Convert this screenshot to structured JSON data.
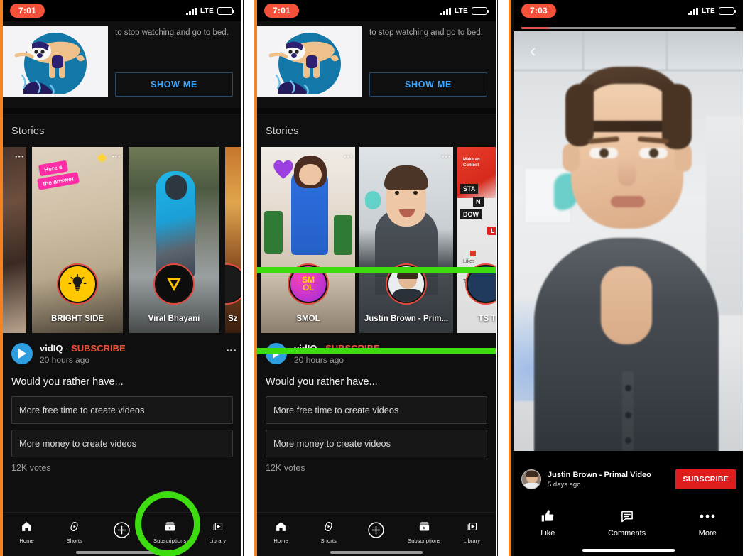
{
  "meta": {
    "accent_orange": "#f58220",
    "highlight_green": "#3ddc10",
    "subscribe_red": "#e01d1d",
    "youtube_dark": "#0f0f0f"
  },
  "panel1": {
    "status": {
      "time": "7:01",
      "network": "LTE"
    },
    "reminder": {
      "body_text": "to stop watching and go to bed.",
      "cta_label": "SHOW ME"
    },
    "stories": {
      "header": "Stories",
      "items": [
        {
          "name": "",
          "partial": "left"
        },
        {
          "name": "BRIGHT SIDE",
          "overlay_text": "Here's the answer"
        },
        {
          "name": "Viral Bhayani",
          "overlay_text": ""
        },
        {
          "name": "Sz",
          "partial": "right"
        }
      ]
    },
    "post": {
      "channel": "vidIQ",
      "separator": "·",
      "subscribe_label": "SUBSCRIBE",
      "timestamp": "20 hours ago",
      "question": "Would you rather have...",
      "options": [
        "More free time to create videos",
        "More money to create videos"
      ],
      "votes": "12K votes"
    },
    "nav": {
      "items": [
        {
          "label": "Home",
          "icon": "home-icon"
        },
        {
          "label": "Shorts",
          "icon": "shorts-icon"
        },
        {
          "label": "",
          "icon": "create-plus-icon"
        },
        {
          "label": "Subscriptions",
          "icon": "subscriptions-icon"
        },
        {
          "label": "Library",
          "icon": "library-icon"
        }
      ],
      "highlighted": "Subscriptions"
    }
  },
  "panel2": {
    "status": {
      "time": "7:01",
      "network": "LTE"
    },
    "reminder": {
      "body_text": "to stop watching and go to bed.",
      "cta_label": "SHOW ME"
    },
    "stories": {
      "header": "Stories",
      "items": [
        {
          "name": "SMOL",
          "badge": "SMOL"
        },
        {
          "name": "Justin Brown - Prim...",
          "badge": ""
        },
        {
          "name": "TS T",
          "partial": "right"
        }
      ],
      "highlighted": true
    },
    "post": {
      "channel": "vidIQ",
      "separator": "·",
      "subscribe_label": "SUBSCRIBE",
      "timestamp": "20 hours ago",
      "question": "Would you rather have...",
      "options": [
        "More free time to create videos",
        "More money to create videos"
      ],
      "votes": "12K votes"
    },
    "nav": {
      "items": [
        {
          "label": "Home",
          "icon": "home-icon"
        },
        {
          "label": "Shorts",
          "icon": "shorts-icon"
        },
        {
          "label": "",
          "icon": "create-plus-icon"
        },
        {
          "label": "Subscriptions",
          "icon": "subscriptions-icon"
        },
        {
          "label": "Library",
          "icon": "library-icon"
        }
      ]
    }
  },
  "panel3": {
    "status": {
      "time": "7:03",
      "network": "LTE"
    },
    "player": {
      "progress_percent": 13,
      "back_icon": "chevron-left-icon",
      "channel_name": "Justin Brown - Primal Video",
      "timestamp": "5 days ago",
      "subscribe_label": "SUBSCRIBE",
      "actions": [
        {
          "label": "Like",
          "icon": "thumbs-up-icon"
        },
        {
          "label": "Comments",
          "icon": "comment-bubble-icon"
        },
        {
          "label": "More",
          "icon": "more-horizontal-icon"
        }
      ]
    }
  }
}
